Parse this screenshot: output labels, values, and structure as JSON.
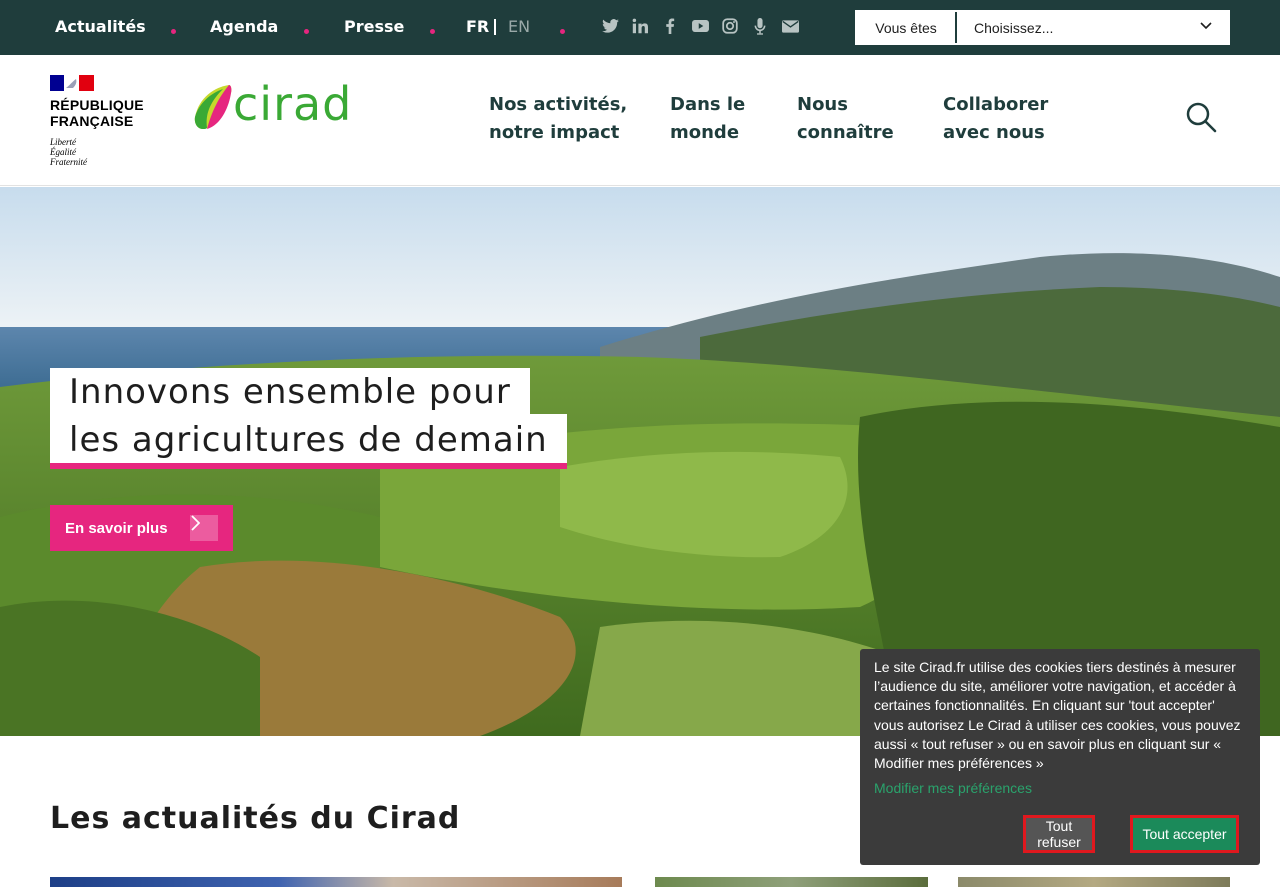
{
  "topbar": {
    "links": [
      "Actualités",
      "Agenda",
      "Presse"
    ],
    "lang_fr": "FR",
    "lang_en": "EN",
    "social_icons": [
      "twitter-icon",
      "linkedin-icon",
      "facebook-icon",
      "youtube-icon",
      "instagram-icon",
      "podcast-icon",
      "mail-icon"
    ],
    "vous_etes_label": "Vous êtes",
    "vous_etes_value": "Choisissez..."
  },
  "header": {
    "rf_title_line1": "RÉPUBLIQUE",
    "rf_title_line2": "FRANÇAISE",
    "rf_motto_line1": "Liberté",
    "rf_motto_line2": "Égalité",
    "rf_motto_line3": "Fraternité",
    "brand": "cirad",
    "nav": [
      {
        "line1": "Nos activités,",
        "line2": "notre impact"
      },
      {
        "line1": "Dans le",
        "line2": "monde"
      },
      {
        "line1": "Nous",
        "line2": "connaître"
      },
      {
        "line1": "Collaborer",
        "line2": "avec nous"
      }
    ]
  },
  "hero": {
    "title_line1": "Innovons ensemble pour",
    "title_line2": "les agricultures de demain",
    "cta_label": "En savoir plus"
  },
  "news": {
    "title": "Les actualités du Cirad"
  },
  "cookie": {
    "text": "Le site Cirad.fr utilise des cookies tiers destinés à mesurer l’audience du site, améliorer votre navigation, et accéder à certaines fonctionnalités. En cliquant sur 'tout accepter' vous autorisez Le Cirad à utiliser ces cookies, vous pouvez aussi « tout refuser » ou en savoir plus en cliquant sur « Modifier mes préférences »",
    "link": "Modifier mes préférences",
    "refuse": "Tout refuser",
    "accept": "Tout accepter"
  },
  "colors": {
    "topbar": "#1f3d3c",
    "accent_pink": "#e6267f",
    "brand_green": "#3aa935",
    "cookie_bg": "#3b3b3b",
    "cookie_accept": "#1b8a5a"
  }
}
